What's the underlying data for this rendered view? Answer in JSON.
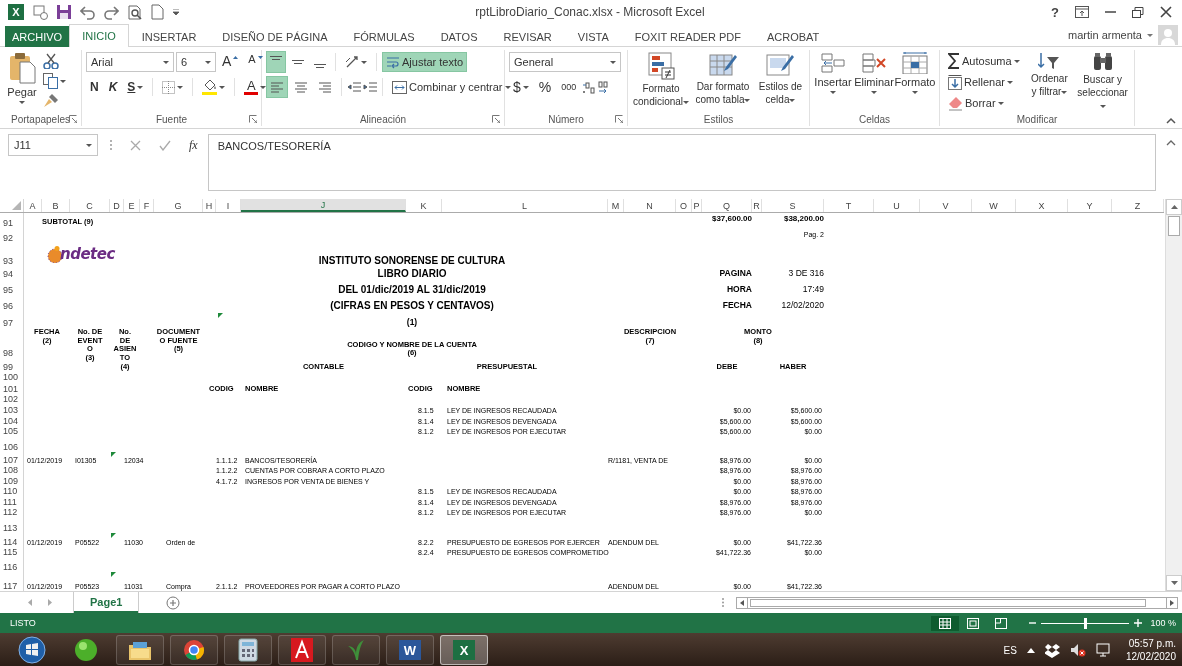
{
  "window": {
    "app_glyph": "X",
    "title": "rptLibroDiario_Conac.xlsx - Microsoft Excel",
    "help": "?"
  },
  "tabs": [
    {
      "label": "ARCHIVO",
      "kind": "file",
      "selected": false
    },
    {
      "label": "INICIO",
      "kind": "tab",
      "selected": true
    },
    {
      "label": "INSERTAR",
      "kind": "tab",
      "selected": false
    },
    {
      "label": "DISEÑO DE PÁGINA",
      "kind": "tab",
      "selected": false
    },
    {
      "label": "FÓRMULAS",
      "kind": "tab",
      "selected": false
    },
    {
      "label": "DATOS",
      "kind": "tab",
      "selected": false
    },
    {
      "label": "REVISAR",
      "kind": "tab",
      "selected": false
    },
    {
      "label": "VISTA",
      "kind": "tab",
      "selected": false
    },
    {
      "label": "FOXIT READER PDF",
      "kind": "tab",
      "selected": false
    },
    {
      "label": "ACROBAT",
      "kind": "tab",
      "selected": false
    }
  ],
  "account": {
    "user": "martin armenta"
  },
  "ribbon": {
    "groups": [
      {
        "kind": "clipboard",
        "label": "Portapapeles",
        "paste": "Pegar"
      },
      {
        "kind": "font",
        "label": "Fuente",
        "font": "Arial",
        "size": "6",
        "grow": "A",
        "shrink": "A",
        "bold": "N",
        "italic": "K",
        "underline": "S",
        "font_color": "A"
      },
      {
        "kind": "alignment",
        "label": "Alineación",
        "vertical": [
          {
            "selected": true
          },
          {
            "selected": false
          },
          {
            "selected": false
          }
        ],
        "horizontal": [
          {
            "selected": true
          },
          {
            "selected": false
          },
          {
            "selected": false
          }
        ],
        "wrap": {
          "label": "Ajustar texto",
          "selected": true
        },
        "merge": "Combinar y centrar"
      },
      {
        "kind": "number",
        "label": "Número",
        "format": "General",
        "currency": "$",
        "percent": "%",
        "thousands": "000"
      },
      {
        "kind": "styles",
        "label": "Estilos",
        "buttons": [
          "Formato condicional",
          "Dar formato como tabla",
          "Estilos de celda"
        ]
      },
      {
        "kind": "cells",
        "label": "Celdas",
        "buttons": [
          "Insertar",
          "Eliminar",
          "Formato"
        ]
      },
      {
        "kind": "editing",
        "label": "Modificar",
        "items": [
          "Autosuma",
          "Rellenar",
          "Borrar"
        ],
        "buttons": [
          "Ordenar y filtrar",
          "Buscar y seleccionar"
        ]
      }
    ]
  },
  "formula_bar": {
    "name_box": "J11",
    "fx": "fx",
    "formula": "BANCOS/TESORERÍA"
  },
  "sheet": {
    "columns": [
      {
        "label": "A",
        "selected": false
      },
      {
        "label": "B",
        "selected": false
      },
      {
        "label": "C",
        "selected": false
      },
      {
        "label": "D",
        "selected": false
      },
      {
        "label": "E",
        "selected": false
      },
      {
        "label": "F",
        "selected": false
      },
      {
        "label": "G",
        "selected": false
      },
      {
        "label": "H",
        "selected": false
      },
      {
        "label": "I",
        "selected": false
      },
      {
        "label": "J",
        "selected": true
      },
      {
        "label": "K",
        "selected": false
      },
      {
        "label": "L",
        "selected": false
      },
      {
        "label": "M",
        "selected": false
      },
      {
        "label": "N",
        "selected": false
      },
      {
        "label": "O",
        "selected": false
      },
      {
        "label": "P",
        "selected": false
      },
      {
        "label": "Q",
        "selected": false
      },
      {
        "label": "R",
        "selected": false
      },
      {
        "label": "S",
        "selected": false
      },
      {
        "label": "T",
        "selected": false
      },
      {
        "label": "U",
        "selected": false
      },
      {
        "label": "V",
        "selected": false
      },
      {
        "label": "W",
        "selected": false
      },
      {
        "label": "X",
        "selected": false
      },
      {
        "label": "Y",
        "selected": false
      },
      {
        "label": "Z",
        "selected": false
      }
    ],
    "rows": [
      {
        "number": "91",
        "cells": [
          {
            "kind": "subtotal_label",
            "text": "SUBTOTAL (9)"
          },
          {
            "kind": "total_debe",
            "text": "$37,600.00"
          },
          {
            "kind": "total_haber",
            "text": "$38,200.00"
          }
        ]
      },
      {
        "number": "92",
        "cells": [
          {
            "kind": "page_note",
            "text": "Pag. 2"
          }
        ]
      },
      {
        "number": "93",
        "cells": [
          {
            "kind": "logo",
            "text": "ndetec"
          },
          {
            "kind": "title",
            "text": "INSTITUTO SONORENSE DE CULTURA"
          }
        ]
      },
      {
        "number": "94",
        "cells": [
          {
            "kind": "title",
            "text": "LIBRO DIARIO"
          },
          {
            "kind": "info_label",
            "text": "PAGINA"
          },
          {
            "kind": "info_value",
            "text": "3 DE 316"
          }
        ]
      },
      {
        "number": "95",
        "cells": [
          {
            "kind": "title",
            "text": "DEL 01/dic/2019 AL 31/dic/2019"
          },
          {
            "kind": "info_label",
            "text": "HORA"
          },
          {
            "kind": "info_value",
            "text": "17:49"
          }
        ]
      },
      {
        "number": "96",
        "cells": [
          {
            "kind": "title",
            "text": "(CIFRAS EN PESOS Y CENTAVOS)"
          },
          {
            "kind": "info_label",
            "text": "FECHA"
          },
          {
            "kind": "info_value",
            "text": "12/02/2020"
          }
        ]
      },
      {
        "number": "97",
        "cells": [
          {
            "kind": "mark_i"
          },
          {
            "kind": "ref",
            "text": "(1)"
          }
        ]
      },
      {
        "number": "98",
        "cells": [
          {
            "kind": "fecha_head",
            "text": "FECHA\n(2)"
          },
          {
            "kind": "evento_head",
            "text": "No. DE\nEVENT\nO\n(3)"
          },
          {
            "kind": "asiento_head",
            "text": "No.\nDE\nASIEN\nTO\n(4)"
          },
          {
            "kind": "documento_head",
            "text": "DOCUMENT\nO FUENTE\n(5)"
          },
          {
            "kind": "cuenta_head",
            "text": "CODIGO Y NOMBRE DE LA CUENTA\n(6)"
          },
          {
            "kind": "descripcion_head",
            "text": "DESCRIPCION\n(7)"
          },
          {
            "kind": "monto_head",
            "text": "MONTO\n(8)"
          }
        ]
      },
      {
        "number": "99",
        "cells": [
          {
            "kind": "contable_head",
            "text": "CONTABLE"
          },
          {
            "kind": "presupuestal_head",
            "text": "PRESUPUESTAL"
          },
          {
            "kind": "debe_head",
            "text": "DEBE"
          },
          {
            "kind": "haber_head",
            "text": "HABER"
          }
        ]
      },
      {
        "number": "100"
      },
      {
        "number": "101",
        "cells": [
          {
            "kind": "codig_head",
            "text": "CODIG"
          },
          {
            "kind": "nombre_head",
            "text": "NOMBRE"
          },
          {
            "kind": "codig_p_head",
            "text": "CODIG"
          },
          {
            "kind": "nombre_p_head",
            "text": "NOMBRE"
          }
        ]
      },
      {
        "number": "102"
      },
      {
        "number": "103",
        "cells": [
          {
            "kind": "codigo_p",
            "text": "8.1.5"
          },
          {
            "kind": "nombre_p",
            "text": "LEY DE INGRESOS RECAUDADA"
          },
          {
            "kind": "debe",
            "text": "$0.00"
          },
          {
            "kind": "haber",
            "text": "$5,600.00"
          }
        ]
      },
      {
        "number": "104",
        "cells": [
          {
            "kind": "codigo_p",
            "text": "8.1.4"
          },
          {
            "kind": "nombre_p",
            "text": "LEY DE INGRESOS DEVENGADA"
          },
          {
            "kind": "debe",
            "text": "$5,600.00"
          },
          {
            "kind": "haber",
            "text": "$5,600.00"
          }
        ]
      },
      {
        "number": "105",
        "cells": [
          {
            "kind": "codigo_p",
            "text": "8.1.2"
          },
          {
            "kind": "nombre_p",
            "text": "LEY DE INGRESOS POR EJECUTAR"
          },
          {
            "kind": "debe",
            "text": "$5,600.00"
          },
          {
            "kind": "haber",
            "text": "$0.00"
          }
        ]
      },
      {
        "number": "106"
      },
      {
        "number": "107",
        "cells": [
          {
            "kind": "fecha",
            "text": "01/12/2019"
          },
          {
            "kind": "evento",
            "text": "I01305"
          },
          {
            "kind": "mark"
          },
          {
            "kind": "asiento",
            "text": "12034"
          },
          {
            "kind": "codigo",
            "text": "1.1.1.2"
          },
          {
            "kind": "nombre",
            "text": "BANCOS/TESORERÍA"
          },
          {
            "kind": "descripcion",
            "text": "R/1181, VENTA DE"
          },
          {
            "kind": "debe",
            "text": "$8,976.00"
          },
          {
            "kind": "haber",
            "text": "$0.00"
          }
        ]
      },
      {
        "number": "108",
        "cells": [
          {
            "kind": "codigo",
            "text": "1.1.2.2"
          },
          {
            "kind": "nombre",
            "text": "CUENTAS POR COBRAR A CORTO PLAZO"
          },
          {
            "kind": "debe",
            "text": "$8,976.00"
          },
          {
            "kind": "haber",
            "text": "$8,976.00"
          }
        ]
      },
      {
        "number": "109",
        "cells": [
          {
            "kind": "codigo",
            "text": "4.1.7.2"
          },
          {
            "kind": "nombre",
            "text": "INGRESOS POR VENTA DE BIENES Y"
          },
          {
            "kind": "debe",
            "text": "$0.00"
          },
          {
            "kind": "haber",
            "text": "$8,976.00"
          }
        ]
      },
      {
        "number": "110",
        "cells": [
          {
            "kind": "codigo_p",
            "text": "8.1.5"
          },
          {
            "kind": "nombre_p",
            "text": "LEY DE INGRESOS RECAUDADA"
          },
          {
            "kind": "debe",
            "text": "$0.00"
          },
          {
            "kind": "haber",
            "text": "$8,976.00"
          }
        ]
      },
      {
        "number": "111",
        "cells": [
          {
            "kind": "codigo_p",
            "text": "8.1.4"
          },
          {
            "kind": "nombre_p",
            "text": "LEY DE INGRESOS DEVENGADA"
          },
          {
            "kind": "debe",
            "text": "$8,976.00"
          },
          {
            "kind": "haber",
            "text": "$8,976.00"
          }
        ]
      },
      {
        "number": "112",
        "cells": [
          {
            "kind": "codigo_p",
            "text": "8.1.2"
          },
          {
            "kind": "nombre_p",
            "text": "LEY DE INGRESOS POR EJECUTAR"
          },
          {
            "kind": "debe",
            "text": "$8,976.00"
          },
          {
            "kind": "haber",
            "text": "$0.00"
          }
        ]
      },
      {
        "number": "113"
      },
      {
        "number": "114",
        "cells": [
          {
            "kind": "fecha",
            "text": "01/12/2019"
          },
          {
            "kind": "evento",
            "text": "P05522"
          },
          {
            "kind": "mark"
          },
          {
            "kind": "asiento",
            "text": "11030"
          },
          {
            "kind": "documento",
            "text": "Orden de"
          },
          {
            "kind": "codigo_p",
            "text": "8.2.2"
          },
          {
            "kind": "nombre_p",
            "text": "PRESUPUESTO DE EGRESOS POR EJERCER"
          },
          {
            "kind": "descripcion",
            "text": "ADENDUM DEL"
          },
          {
            "kind": "debe",
            "text": "$0.00"
          },
          {
            "kind": "haber",
            "text": "$41,722.36"
          }
        ]
      },
      {
        "number": "115",
        "cells": [
          {
            "kind": "codigo_p",
            "text": "8.2.4"
          },
          {
            "kind": "nombre_p",
            "text": "PRESUPUESTO DE EGRESOS COMPROMETIDO"
          },
          {
            "kind": "debe",
            "text": "$41,722.36"
          },
          {
            "kind": "haber",
            "text": "$0.00"
          }
        ]
      },
      {
        "number": "116"
      },
      {
        "number": "117",
        "cells": [
          {
            "kind": "fecha",
            "text": "01/12/2019"
          },
          {
            "kind": "evento",
            "text": "P05523"
          },
          {
            "kind": "mark"
          },
          {
            "kind": "asiento",
            "text": "11031"
          },
          {
            "kind": "documento",
            "text": "Compra"
          },
          {
            "kind": "codigo",
            "text": "2.1.1.2"
          },
          {
            "kind": "nombre",
            "text": "PROVEEDORES POR PAGAR A CORTO PLAZO"
          },
          {
            "kind": "descripcion",
            "text": "ADENDUM DEL"
          },
          {
            "kind": "debe",
            "text": "$0.00"
          },
          {
            "kind": "haber",
            "text": "$41,722.36"
          }
        ]
      }
    ]
  },
  "sheet_tabs": [
    {
      "label": "Page1",
      "selected": true
    }
  ],
  "status_bar": {
    "status": "LISTO",
    "views": [
      {
        "selected": true
      },
      {
        "selected": false
      },
      {
        "selected": false
      }
    ],
    "zoom": {
      "level": 0.5,
      "label": "100 %"
    }
  },
  "taskbar": {
    "apps": [
      {
        "kind": "start",
        "selected": false
      },
      {
        "kind": "orb",
        "selected": false
      },
      {
        "kind": "explorer",
        "selected": false
      },
      {
        "kind": "chrome",
        "selected": false
      },
      {
        "kind": "calculator",
        "selected": false
      },
      {
        "kind": "acrobat",
        "selected": false
      },
      {
        "kind": "plant",
        "selected": false
      },
      {
        "kind": "word",
        "glyph": "W",
        "selected": false
      },
      {
        "kind": "excel",
        "glyph": "X",
        "selected": true
      }
    ],
    "language": "ES",
    "time": "05:57 p.m.",
    "date": "12/02/2020"
  }
}
